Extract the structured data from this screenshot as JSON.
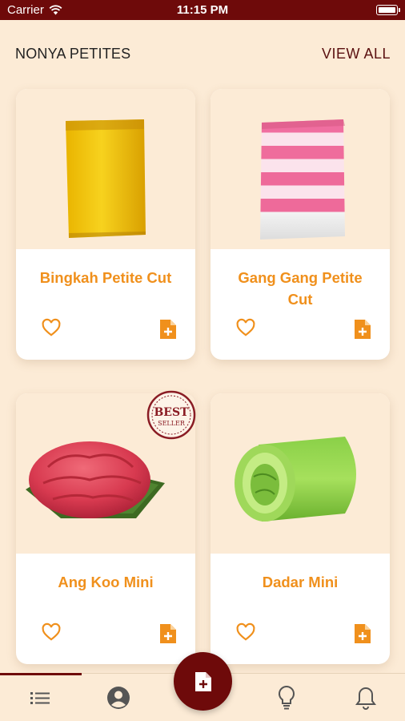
{
  "status_bar": {
    "carrier": "Carrier",
    "time": "11:15 PM"
  },
  "section": {
    "title": "NONYA PETITES",
    "view_all": "VIEW ALL"
  },
  "products": [
    {
      "name": "Bingkah Petite Cut"
    },
    {
      "name": "Gang Gang Petite Cut"
    },
    {
      "name": "Ang Koo Mini",
      "badge": {
        "top": "BEST",
        "bottom": "SELLER"
      }
    },
    {
      "name": "Dadar Mini"
    }
  ],
  "icons": {
    "favorite": "heart-outline-icon",
    "add": "document-add-icon",
    "nav": [
      "list-icon",
      "account-circle-icon",
      "add-document-fab",
      "lightbulb-icon",
      "bell-icon"
    ]
  },
  "colors": {
    "accent": "#f0901c",
    "brand": "#6e0a0a",
    "background": "#fcebd6"
  }
}
